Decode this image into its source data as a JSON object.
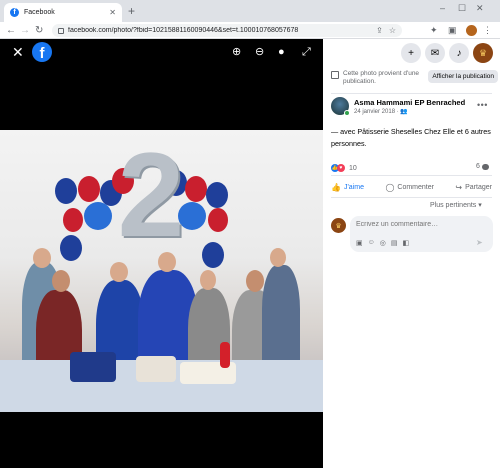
{
  "browser": {
    "tab_title": "Facebook",
    "tab_favicon": "f",
    "url": "facebook.com/photo/?fbid=10215881160090446&set=t.100010768057678",
    "window_controls": [
      "–",
      "☐",
      "✕"
    ]
  },
  "viewer": {
    "close_icon": "✕",
    "logo_text": "f",
    "tools": [
      "zoom-in-icon",
      "zoom-out-icon",
      "tag-icon",
      "fullscreen-icon"
    ],
    "photo_label": "2"
  },
  "panel": {
    "notice_text": "Cette photo provient d'une publication.",
    "notice_button": "Afficher la publication",
    "author": "Asma Hammami EP Benrached",
    "date": "24 janvier 2018 · ",
    "description": "— avec Pâtisserie Sheselles Chez Elle et 6 autres personnes.",
    "reaction_count": "10",
    "comment_count": "6",
    "actions": {
      "like": "J'aime",
      "comment": "Commenter",
      "share": "Partager"
    },
    "sort_label": "Plus pertinents ▾",
    "comment_placeholder": "Écrivez un commentaire…"
  },
  "colors": {
    "brand": "#1877f2",
    "viewer_bg": "#000000",
    "panel_bg": "#ffffff"
  }
}
